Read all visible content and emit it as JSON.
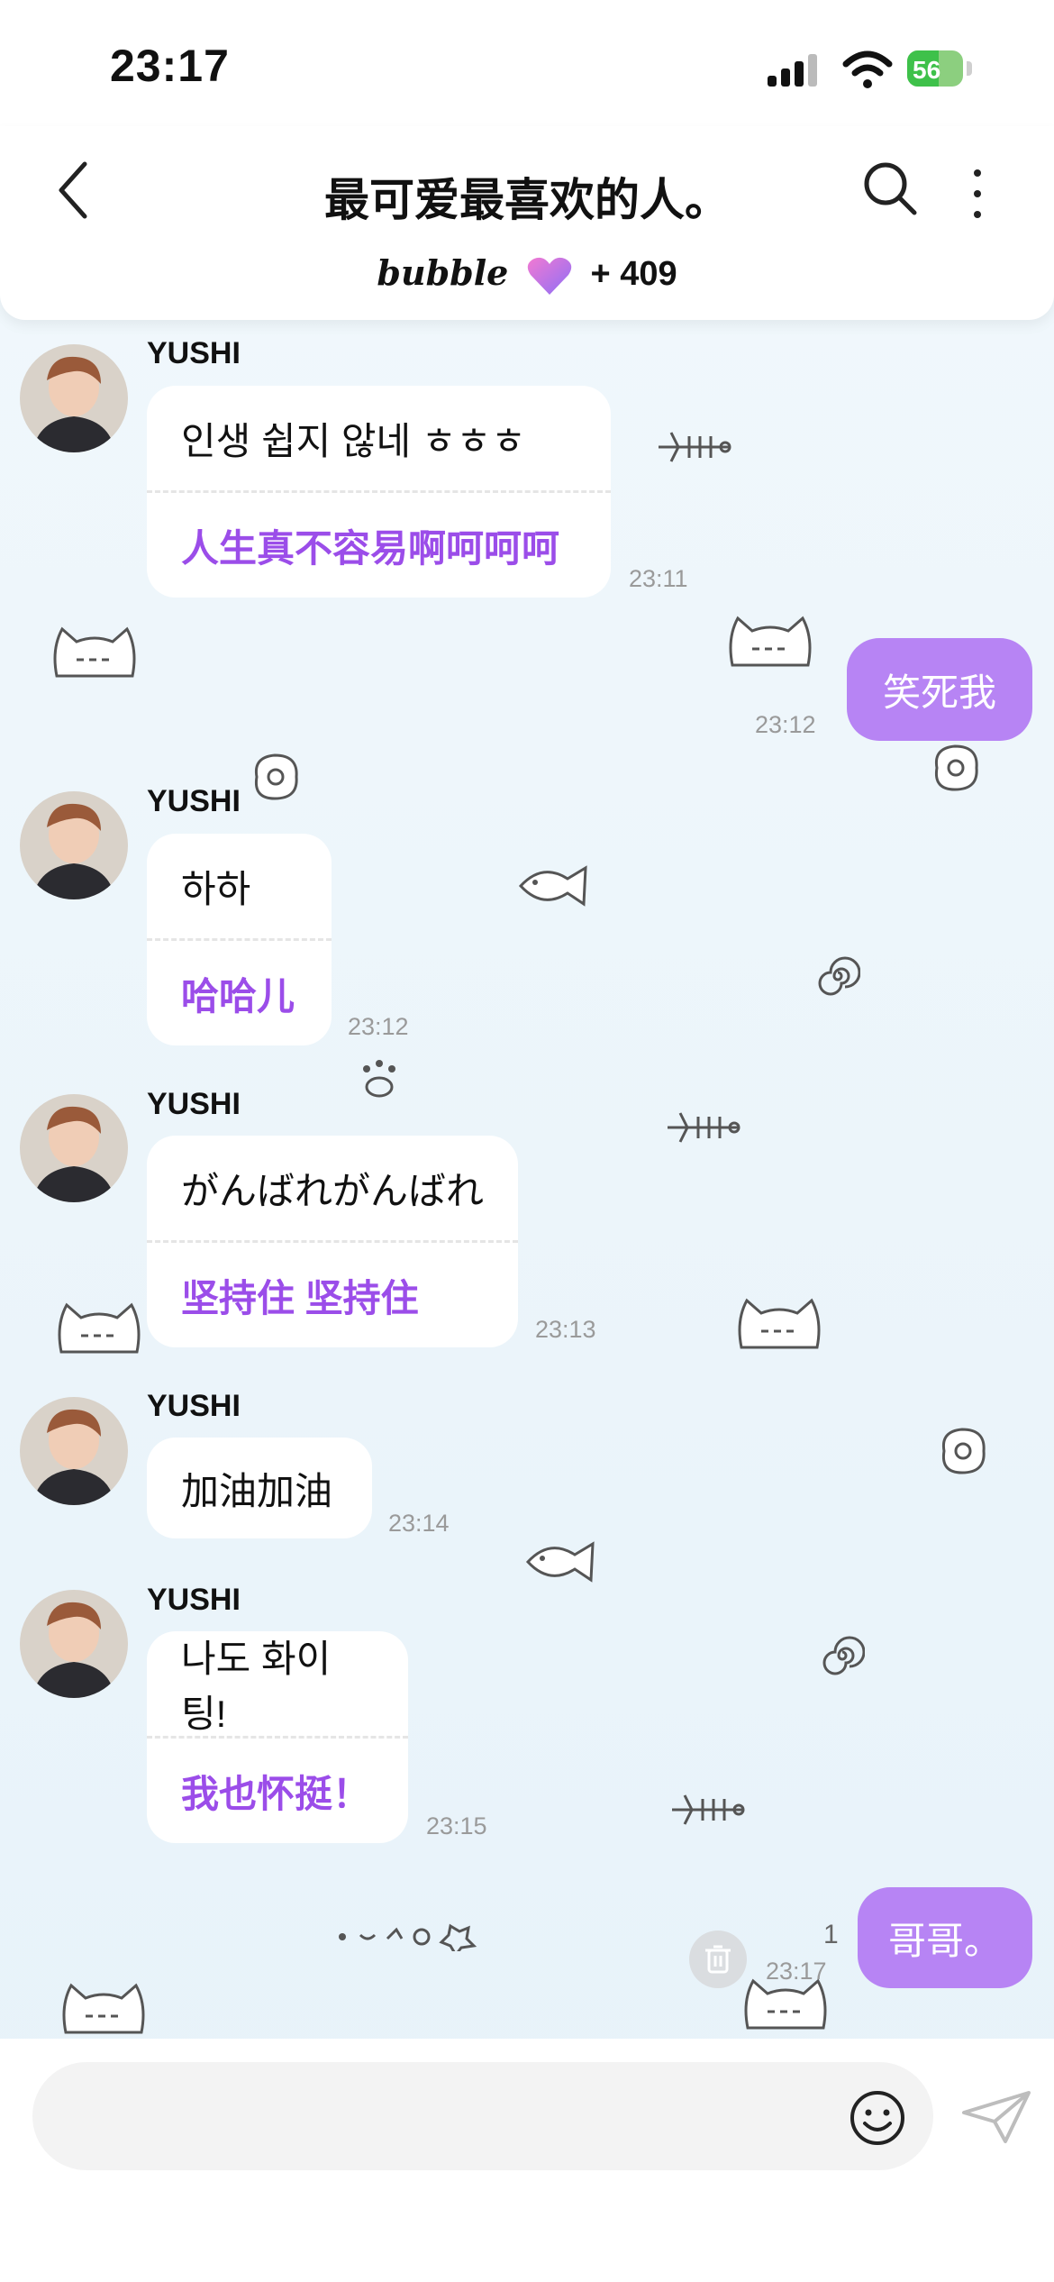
{
  "status_bar": {
    "time": "23:17",
    "battery": "56"
  },
  "header": {
    "title": "最可爱最喜欢的人。",
    "brand": "bubble",
    "bubble_count": "+ 409"
  },
  "messages": [
    {
      "sender": "YUSHI",
      "original": "인생 쉽지 않네 ㅎㅎㅎ",
      "translation": "人生真不容易啊呵呵呵",
      "time": "23:11"
    },
    {
      "mine": "笑死我",
      "time": "23:12"
    },
    {
      "sender": "YUSHI",
      "original": "하하",
      "translation": "哈哈儿",
      "time": "23:12"
    },
    {
      "sender": "YUSHI",
      "original": "がんばれがんばれ",
      "translation": "坚持住 坚持住",
      "time": "23:13"
    },
    {
      "sender": "YUSHI",
      "original": "加油加油",
      "time": "23:14"
    },
    {
      "sender": "YUSHI",
      "original": "나도 화이팅!",
      "translation": "我也怀挺！",
      "time": "23:15"
    },
    {
      "mine": "哥哥。",
      "time": "23:17",
      "unread": "1"
    }
  ],
  "colors": {
    "accent": "#b784f4",
    "translation": "#9b4de9"
  },
  "icons": [
    "back-icon",
    "search-icon",
    "more-icon",
    "heart-icon",
    "trash-icon",
    "emoji-icon",
    "send-icon"
  ]
}
